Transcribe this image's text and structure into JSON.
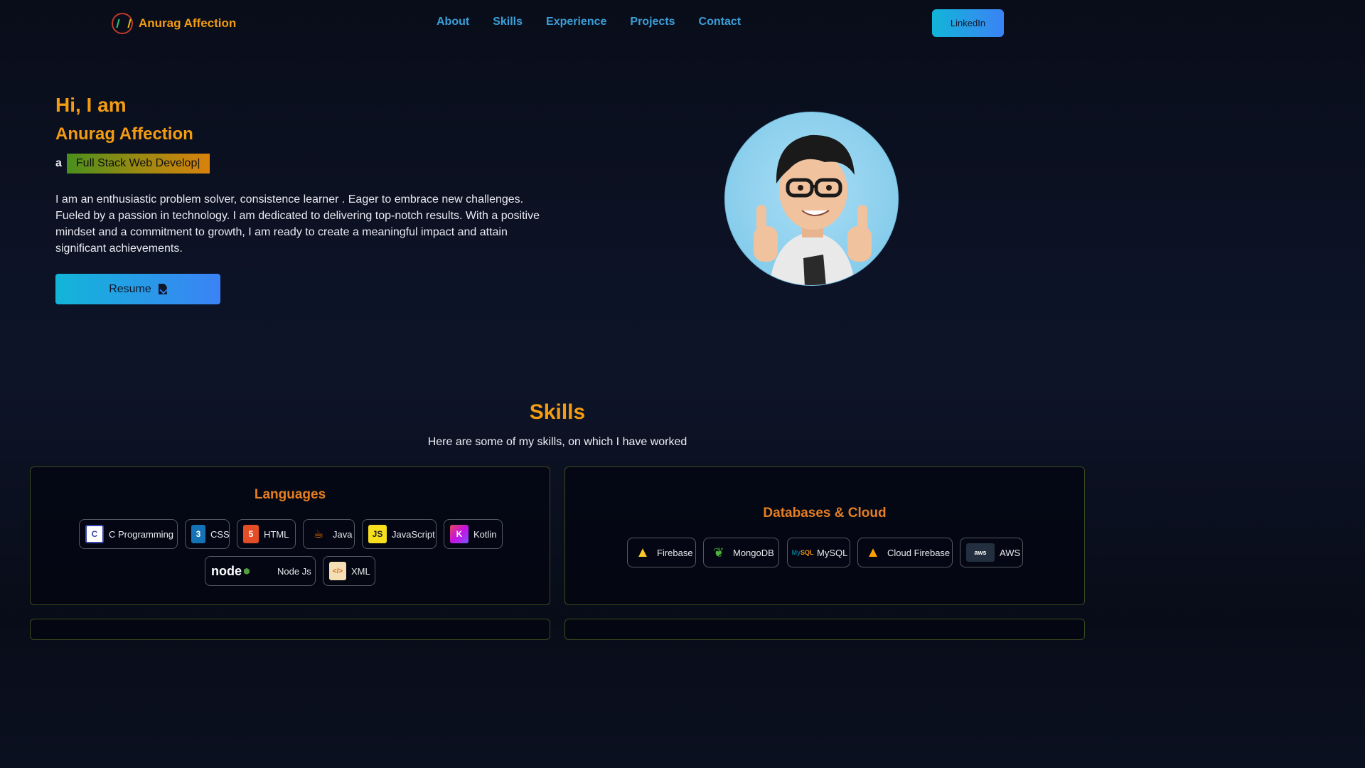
{
  "nav": {
    "brand": "Anurag Affection",
    "links": [
      "About",
      "Skills",
      "Experience",
      "Projects",
      "Contact"
    ],
    "linkedin_label": "LinkedIn"
  },
  "hero": {
    "greeting": "Hi, I am",
    "name": "Anurag Affection",
    "role_prefix": "a",
    "role_typed": "Full Stack Web Develop|",
    "bio": "I am an enthusiastic problem solver, consistence learner . Eager to embrace new challenges. Fueled by a passion in technology. I am dedicated to delivering top-notch results. With a positive mindset and a commitment to growth, I am ready to create a meaningful impact and attain significant achievements.",
    "resume_label": "Resume"
  },
  "skills": {
    "title": "Skills",
    "subtitle": "Here are some of my skills, on which I have worked",
    "languages": {
      "title": "Languages",
      "items": [
        "C Programming",
        "CSS",
        "HTML",
        "Java",
        "JavaScript",
        "Kotlin",
        "Node Js",
        "XML"
      ]
    },
    "databases": {
      "title": "Databases & Cloud",
      "items": [
        "Firebase",
        "MongoDB",
        "MySQL",
        "Cloud Firebase",
        "AWS"
      ]
    }
  },
  "colors": {
    "accent": "#f39c12",
    "nav_link": "#3b9fd8",
    "button_gradient_start": "#12b5d8",
    "button_gradient_end": "#3b82f6"
  }
}
